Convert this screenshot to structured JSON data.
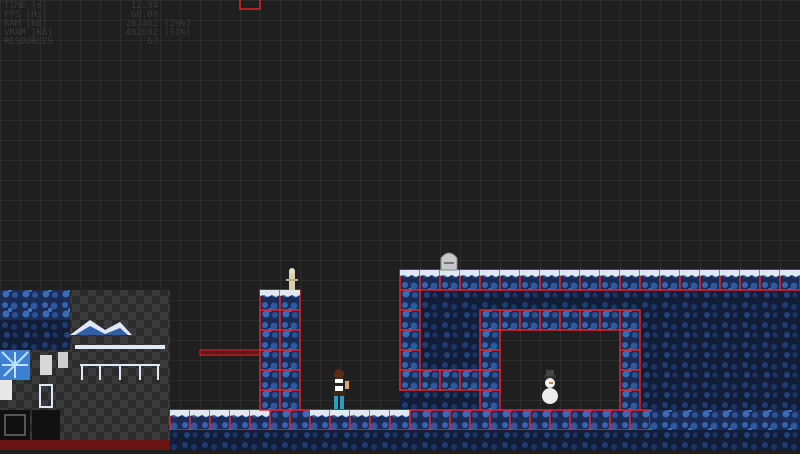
{
  "debug_overlay": {
    "rows": [
      {
        "label": "TIME [s]",
        "value": "12.34",
        "extra": ""
      },
      {
        "label": "FPS [Hz]",
        "value": "60.00",
        "extra": ""
      },
      {
        "label": "RAM [KB]",
        "value": "282482",
        "extra": "(29%)"
      },
      {
        "label": "VRAM [KB]",
        "value": "482692",
        "extra": "(51%)"
      },
      {
        "label": "RESOURCES",
        "value": "67",
        "extra": ""
      }
    ]
  },
  "colors": {
    "background": "#1f1f1f",
    "grid_line": "#3a3a3a",
    "tile_outline": "#e0242f",
    "ice_blue": "#2f5fa8",
    "ice_dark": "#14223f",
    "snow": "#dfe9f5"
  },
  "sprites": {
    "player": "adventurer-girl-sprite",
    "snowman": "snowman-enemy-sprite",
    "tombstone": "tombstone-sprite",
    "skeleton": "skeleton-sprite"
  },
  "tileset_palette": {
    "label": "tileset-palette"
  }
}
